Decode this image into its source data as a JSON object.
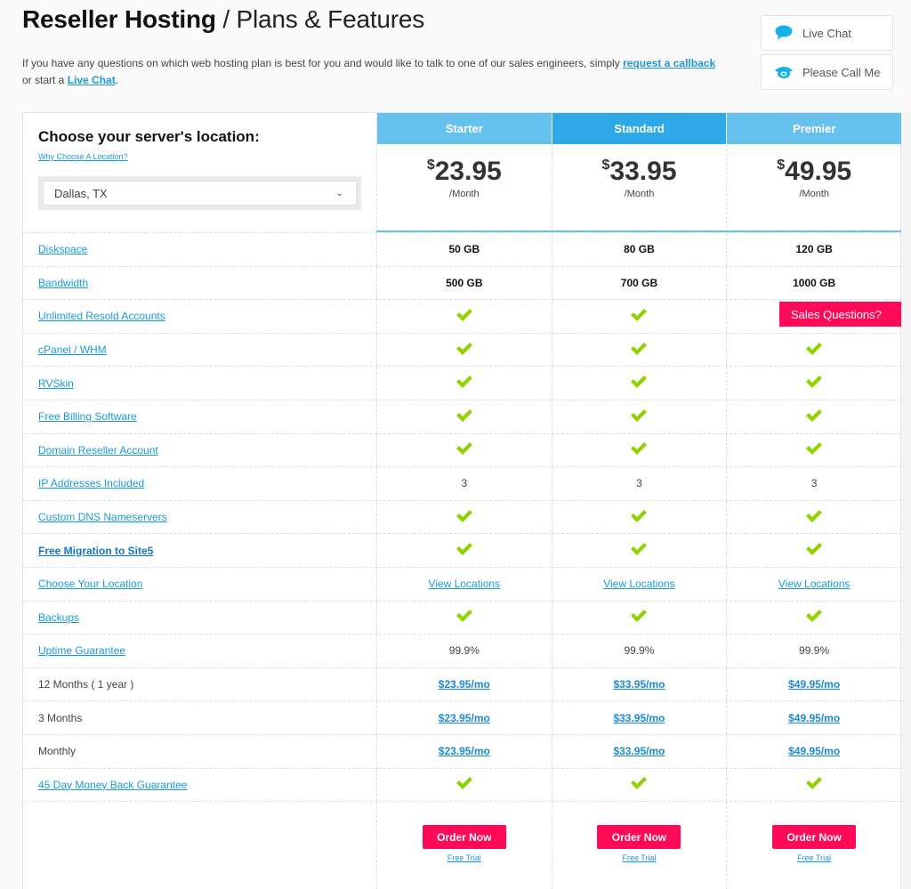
{
  "header": {
    "title_strong": "Reseller Hosting",
    "title_light": " / Plans & Features",
    "intro_text_1": "If you have any questions on which web hosting plan is best for you and would like to talk to one of our sales engineers, simply ",
    "intro_link_callback": "request a callback",
    "intro_text_2": " or start a ",
    "intro_link_chat": "Live Chat",
    "intro_text_3": "."
  },
  "contact": {
    "live_chat": {
      "label": "Live Chat",
      "icon": "chat-bubble-icon"
    },
    "call_me": {
      "label": "Please Call Me",
      "icon": "phone-icon"
    }
  },
  "location": {
    "heading": "Choose your server's location:",
    "why_link": "Why Choose A Location?",
    "selected": "Dallas, TX"
  },
  "colors": {
    "header_light": "#66c1ef",
    "header_featured": "#2ea8e6",
    "accent_pink": "#ff0a56",
    "check_green": "#8fd400",
    "link_blue": "#1a9ad9"
  },
  "plans": [
    {
      "name": "Starter",
      "currency": "$",
      "price": "23.95",
      "period": "/Month",
      "featured": false
    },
    {
      "name": "Standard",
      "currency": "$",
      "price": "33.95",
      "period": "/Month",
      "featured": true
    },
    {
      "name": "Premier",
      "currency": "$",
      "price": "49.95",
      "period": "/Month",
      "featured": false
    }
  ],
  "features": [
    {
      "label": "Diskspace",
      "style": "link",
      "values": [
        {
          "type": "bold",
          "text": "50 GB"
        },
        {
          "type": "bold",
          "text": "80 GB"
        },
        {
          "type": "bold",
          "text": "120 GB"
        }
      ]
    },
    {
      "label": "Bandwidth",
      "style": "link",
      "values": [
        {
          "type": "bold",
          "text": "500 GB"
        },
        {
          "type": "bold",
          "text": "700 GB"
        },
        {
          "type": "bold",
          "text": "1000 GB"
        }
      ]
    },
    {
      "label": "Unlimited Resold Accounts",
      "style": "link",
      "values": [
        {
          "type": "check"
        },
        {
          "type": "check"
        },
        {
          "type": "check"
        }
      ]
    },
    {
      "label": "cPanel / WHM",
      "style": "link",
      "values": [
        {
          "type": "check"
        },
        {
          "type": "check"
        },
        {
          "type": "check"
        }
      ]
    },
    {
      "label": "RVSkin",
      "style": "link",
      "values": [
        {
          "type": "check"
        },
        {
          "type": "check"
        },
        {
          "type": "check"
        }
      ]
    },
    {
      "label": "Free Billing Software",
      "style": "link",
      "values": [
        {
          "type": "check"
        },
        {
          "type": "check"
        },
        {
          "type": "check"
        }
      ]
    },
    {
      "label": "Domain Reseller Account",
      "style": "link",
      "values": [
        {
          "type": "check"
        },
        {
          "type": "check"
        },
        {
          "type": "check"
        }
      ]
    },
    {
      "label": "IP Addresses Included",
      "style": "link",
      "values": [
        {
          "type": "text",
          "text": "3"
        },
        {
          "type": "text",
          "text": "3"
        },
        {
          "type": "text",
          "text": "3"
        }
      ]
    },
    {
      "label": "Custom DNS Nameservers",
      "style": "link",
      "values": [
        {
          "type": "check"
        },
        {
          "type": "check"
        },
        {
          "type": "check"
        }
      ]
    },
    {
      "label": "Free Migration to Site5",
      "style": "bold-link",
      "values": [
        {
          "type": "check"
        },
        {
          "type": "check"
        },
        {
          "type": "check"
        }
      ]
    },
    {
      "label": "Choose Your Location",
      "style": "link",
      "values": [
        {
          "type": "link",
          "text": "View Locations"
        },
        {
          "type": "link",
          "text": "View Locations"
        },
        {
          "type": "link",
          "text": "View Locations"
        }
      ]
    },
    {
      "label": "Backups",
      "style": "link",
      "values": [
        {
          "type": "check"
        },
        {
          "type": "check"
        },
        {
          "type": "check"
        }
      ]
    },
    {
      "label": "Uptime Guarantee",
      "style": "link",
      "values": [
        {
          "type": "text",
          "text": "99.9%"
        },
        {
          "type": "text",
          "text": "99.9%"
        },
        {
          "type": "text",
          "text": "99.9%"
        }
      ]
    },
    {
      "label": "12 Months ( 1 year )",
      "style": "plain",
      "values": [
        {
          "type": "price",
          "text": "$23.95/mo"
        },
        {
          "type": "price",
          "text": "$33.95/mo"
        },
        {
          "type": "price",
          "text": "$49.95/mo"
        }
      ]
    },
    {
      "label": "3 Months",
      "style": "plain",
      "values": [
        {
          "type": "price",
          "text": "$23.95/mo"
        },
        {
          "type": "price",
          "text": "$33.95/mo"
        },
        {
          "type": "price",
          "text": "$49.95/mo"
        }
      ]
    },
    {
      "label": "Monthly",
      "style": "plain",
      "values": [
        {
          "type": "price",
          "text": "$23.95/mo"
        },
        {
          "type": "price",
          "text": "$33.95/mo"
        },
        {
          "type": "price",
          "text": "$49.95/mo"
        }
      ]
    },
    {
      "label": "45 Day Money Back Guarantee",
      "style": "link",
      "values": [
        {
          "type": "check"
        },
        {
          "type": "check"
        },
        {
          "type": "check"
        }
      ]
    }
  ],
  "actions": {
    "order_label": "Order Now",
    "trial_label": "Free Trial"
  },
  "sales_tab": {
    "label": "Sales Questions?"
  }
}
